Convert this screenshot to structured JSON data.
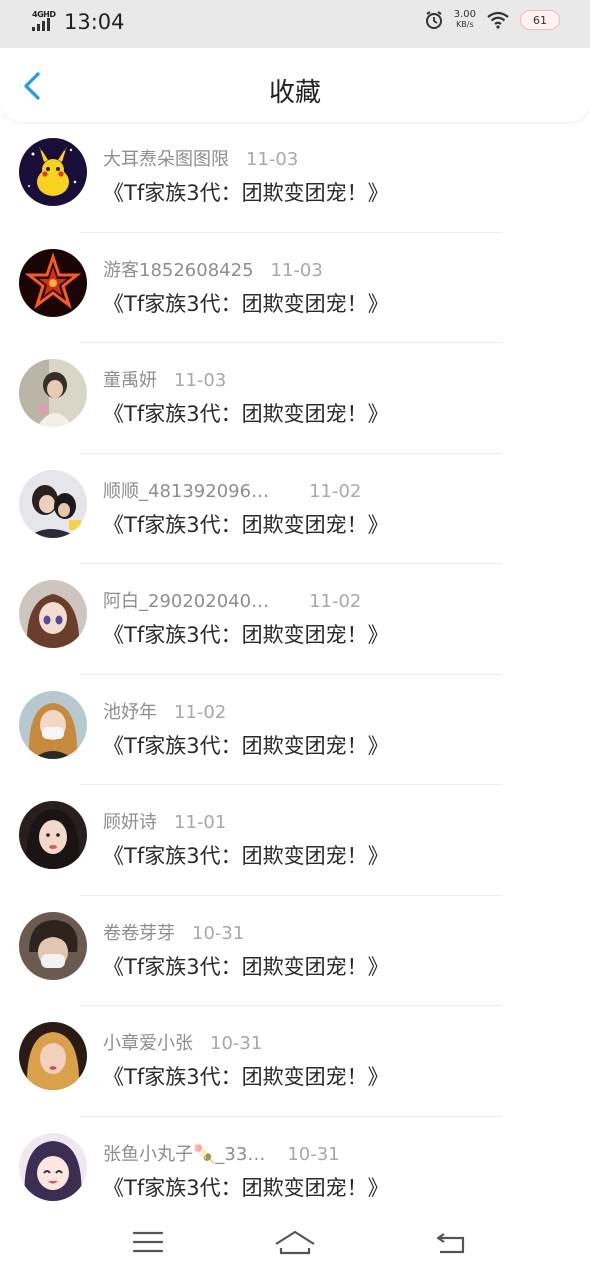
{
  "status_bar": {
    "network": "4GHD",
    "time": "13:04",
    "speed_value": "3.00",
    "speed_unit": "KB/s",
    "battery": "61"
  },
  "header": {
    "title": "收藏"
  },
  "favorites": [
    {
      "name": "大耳焘朵图图限",
      "date": "11-03",
      "work": "《Tf家族3代：团欺变团宠！》"
    },
    {
      "name": "游客1852608425",
      "date": "11-03",
      "work": "《Tf家族3代：团欺变团宠！》"
    },
    {
      "name": "童禹妍",
      "date": "11-03",
      "work": "《Tf家族3代：团欺变团宠！》"
    },
    {
      "name": "顺顺_481392096…",
      "date": "11-02",
      "work": "《Tf家族3代：团欺变团宠！》"
    },
    {
      "name": "阿白_290202040…",
      "date": "11-02",
      "work": "《Tf家族3代：团欺变团宠！》"
    },
    {
      "name": "池妤年",
      "date": "11-02",
      "work": "《Tf家族3代：团欺变团宠！》"
    },
    {
      "name": "顾妍诗",
      "date": "11-01",
      "work": "《Tf家族3代：团欺变团宠！》"
    },
    {
      "name": "卷卷芽芽",
      "date": "10-31",
      "work": "《Tf家族3代：团欺变团宠！》"
    },
    {
      "name": "小章爱小张",
      "date": "10-31",
      "work": "《Tf家族3代：团欺变团宠！》"
    },
    {
      "name": "张鱼小丸子🍡_33…",
      "date": "10-31",
      "work": "《Tf家族3代：团欺变团宠！》"
    }
  ],
  "colors": {
    "accent": "#1e9bf0",
    "status_bar_bg": "#e9e9e9",
    "meta_text": "#9a9a9a",
    "work_text": "#2a2a2a"
  },
  "icons": {
    "back": "chevron-left-icon",
    "nav_menu": "menu-icon",
    "nav_home": "home-icon",
    "nav_back": "return-icon"
  }
}
